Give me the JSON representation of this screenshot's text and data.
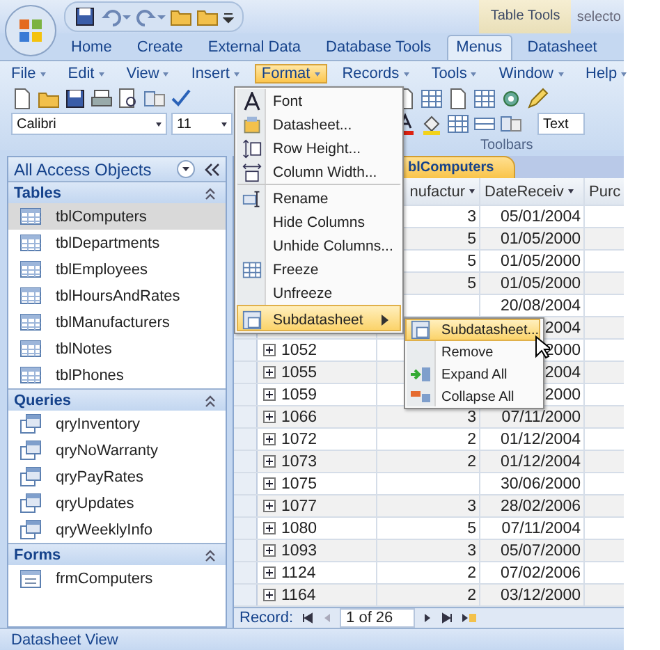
{
  "title_bar": {
    "context_group": "Table Tools",
    "title": "selecto"
  },
  "ribbon_tabs": [
    {
      "label": "Home",
      "selected": false
    },
    {
      "label": "Create",
      "selected": false
    },
    {
      "label": "External Data",
      "selected": false
    },
    {
      "label": "Database Tools",
      "selected": false
    },
    {
      "label": "Menus",
      "selected": true
    },
    {
      "label": "Datasheet",
      "selected": false
    }
  ],
  "menu_bar": [
    {
      "label": "File",
      "selected": false
    },
    {
      "label": "Edit",
      "selected": false
    },
    {
      "label": "View",
      "selected": false
    },
    {
      "label": "Insert",
      "selected": false
    },
    {
      "label": "Format",
      "selected": true
    },
    {
      "label": "Records",
      "selected": false
    },
    {
      "label": "Tools",
      "selected": false
    },
    {
      "label": "Window",
      "selected": false
    },
    {
      "label": "Help",
      "selected": false
    }
  ],
  "toolbar": {
    "font": "Calibri",
    "font_size": "11",
    "data_type": "Text",
    "group_label": "Toolbars"
  },
  "navigation_pane": {
    "title": "All Access Objects",
    "groups": [
      {
        "name": "Tables",
        "kind": "table",
        "items": [
          {
            "label": "tblComputers",
            "selected": true
          },
          {
            "label": "tblDepartments",
            "selected": false
          },
          {
            "label": "tblEmployees",
            "selected": false
          },
          {
            "label": "tblHoursAndRates",
            "selected": false
          },
          {
            "label": "tblManufacturers",
            "selected": false
          },
          {
            "label": "tblNotes",
            "selected": false
          },
          {
            "label": "tblPhones",
            "selected": false
          }
        ]
      },
      {
        "name": "Queries",
        "kind": "query",
        "items": [
          {
            "label": "qryInventory",
            "selected": false
          },
          {
            "label": "qryNoWarranty",
            "selected": false
          },
          {
            "label": "qryPayRates",
            "selected": false
          },
          {
            "label": "qryUpdates",
            "selected": false
          },
          {
            "label": "qryWeeklyInfo",
            "selected": false
          }
        ]
      },
      {
        "name": "Forms",
        "kind": "form",
        "items": [
          {
            "label": "frmComputers",
            "selected": false
          }
        ]
      }
    ]
  },
  "datasheet": {
    "tab": "blComputers",
    "columns": [
      "nufactur",
      "DateReceiv",
      "Purc"
    ],
    "rows": [
      {
        "column_2": "3",
        "column_3": "05/01/2004"
      },
      {
        "column_2": "5",
        "column_3": "01/05/2000"
      },
      {
        "column_2": "5",
        "column_3": "01/05/2000"
      },
      {
        "column_2": "5",
        "column_3": "01/05/2000"
      },
      {
        "column_3": "20/08/2004"
      },
      {
        "column_3": "2004"
      },
      {
        "column_1": "1052",
        "column_3": "2000"
      },
      {
        "column_1": "1055",
        "column_3": "2004"
      },
      {
        "column_1": "1059",
        "column_3": "2000"
      },
      {
        "column_1": "1066",
        "column_2": "3",
        "column_3": "07/11/2000"
      },
      {
        "column_1": "1072",
        "column_2": "2",
        "column_3": "01/12/2004"
      },
      {
        "column_1": "1073",
        "column_2": "2",
        "column_3": "01/12/2004"
      },
      {
        "column_1": "1075",
        "column_3": "30/06/2000"
      },
      {
        "column_1": "1077",
        "column_2": "3",
        "column_3": "28/02/2006"
      },
      {
        "column_1": "1080",
        "column_2": "5",
        "column_3": "07/11/2004"
      },
      {
        "column_1": "1093",
        "column_2": "3",
        "column_3": "05/07/2000"
      },
      {
        "column_1": "1124",
        "column_2": "2",
        "column_3": "07/02/2006"
      },
      {
        "column_1": "1164",
        "column_2": "2",
        "column_3": "03/12/2000"
      }
    ],
    "record_label": "Record:",
    "record_position": "1 of 26"
  },
  "format_menu": [
    {
      "label": "Font",
      "separator_before": false,
      "submenu": false,
      "selected": false
    },
    {
      "label": "Datasheet...",
      "separator_before": false,
      "submenu": false,
      "selected": false
    },
    {
      "label": "Row Height...",
      "separator_before": false,
      "submenu": false,
      "selected": false
    },
    {
      "label": "Column Width...",
      "separator_before": false,
      "submenu": false,
      "selected": false
    },
    {
      "label": "Rename",
      "separator_before": true,
      "submenu": false,
      "selected": false
    },
    {
      "label": "Hide Columns",
      "separator_before": false,
      "submenu": false,
      "selected": false
    },
    {
      "label": "Unhide Columns...",
      "separator_before": false,
      "submenu": false,
      "selected": false
    },
    {
      "label": "Freeze",
      "separator_before": false,
      "submenu": false,
      "selected": false
    },
    {
      "label": "Unfreeze",
      "separator_before": false,
      "submenu": false,
      "selected": false
    },
    {
      "label": "Subdatasheet",
      "separator_before": true,
      "submenu": true,
      "selected": true
    }
  ],
  "submenu": [
    {
      "label": "Subdatasheet...",
      "selected": true
    },
    {
      "label": "Remove",
      "selected": false
    },
    {
      "label": "Expand All",
      "selected": false
    },
    {
      "label": "Collapse All",
      "selected": false
    }
  ],
  "status_bar": "Datasheet View"
}
